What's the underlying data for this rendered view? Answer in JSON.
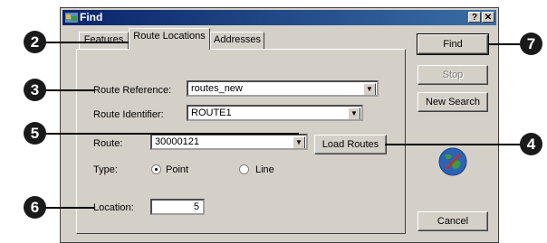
{
  "window": {
    "title": "Find",
    "help_label": "?",
    "close_label": "✕"
  },
  "tabs": [
    {
      "label": "Features"
    },
    {
      "label": "Route Locations"
    },
    {
      "label": "Addresses"
    }
  ],
  "form": {
    "route_reference": {
      "label": "Route Reference:",
      "value": "routes_new"
    },
    "route_identifier": {
      "label": "Route Identifier:",
      "value": "ROUTE1"
    },
    "route": {
      "label": "Route:",
      "value": "30000121"
    },
    "load_routes_label": "Load Routes",
    "type": {
      "label": "Type:",
      "options": [
        {
          "label": "Point",
          "selected": true
        },
        {
          "label": "Line",
          "selected": false
        }
      ]
    },
    "location": {
      "label": "Location:",
      "value": "5"
    }
  },
  "side_buttons": {
    "find": "Find",
    "stop": "Stop",
    "new_search": "New Search",
    "cancel": "Cancel"
  },
  "callouts": [
    "2",
    "3",
    "5",
    "6",
    "7",
    "4"
  ],
  "colors": {
    "titlebar": "#0a246a",
    "window": "#d4d0c8",
    "callout": "#1a1a1a"
  }
}
